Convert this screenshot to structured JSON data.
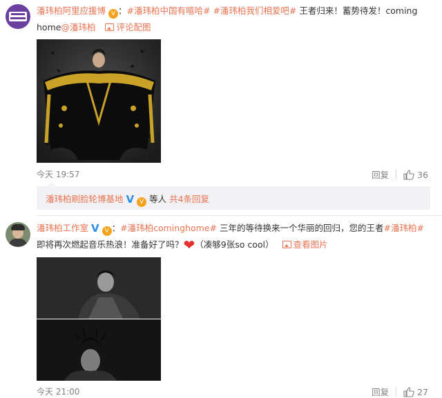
{
  "comment1": {
    "username": "潘玮柏阿里应援博",
    "colon": "：",
    "hashtag1": "#潘玮柏中国有嘻哈#",
    "hashtag2": "#潘玮柏我们相爱吧#",
    "text": "王者归来！蓄势待发！coming",
    "text2_prefix": "home",
    "mention": "@潘玮柏",
    "pic_link": "评论配图",
    "time": "今天 19:57",
    "reply_label": "回复",
    "like_count": "36",
    "avatar_text": "潘玮柏 阿里应援博"
  },
  "reply_summary": {
    "user": "潘玮柏刷脸轮博基地",
    "and_others": "等人",
    "count_link": "共4条回复"
  },
  "comment2": {
    "username": "潘玮柏工作室",
    "colon": "：",
    "hashtag1": "#潘玮柏cominghome#",
    "text1": "三年的等待换来一个华丽的回归，您的王者",
    "hashtag2": "#潘玮柏#",
    "text2": "即将再次燃起音乐热浪！准备好了吗？",
    "text3": "（凑够9张so cool）",
    "pic_link": "查看图片",
    "time": "今天 21:00",
    "reply_label": "回复",
    "like_count": "27"
  },
  "colors": {
    "link": "#eb7350",
    "meta": "#808080",
    "reply_bg": "#f2f2f5"
  }
}
